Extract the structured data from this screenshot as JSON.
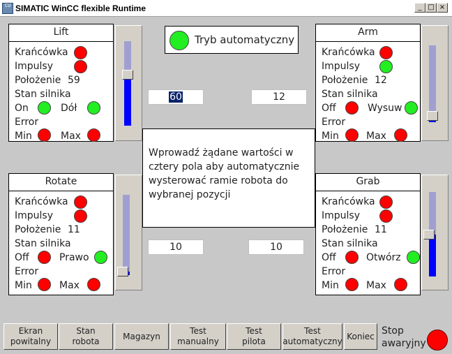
{
  "window": {
    "title": "SIMATIC WinCC flexible Runtime",
    "icon_label": "CU",
    "btn_min": "_",
    "btn_max": "□",
    "btn_close": "×"
  },
  "labels": {
    "limit": "Krańcówka",
    "impulses": "Impulsy",
    "position": "Położenie",
    "motor_state": "Stan silnika",
    "error": "Error",
    "min": "Min",
    "max": "Max"
  },
  "auto_mode": {
    "label": "Tryb automatyczny",
    "led": "green"
  },
  "panels": {
    "lift": {
      "title": "Lift",
      "limit_led": "red",
      "impulses_led": "red",
      "position": "59",
      "on_off": "On",
      "on_off_led": "green",
      "direction": "Dół",
      "direction_led": "green",
      "min_led": "red",
      "max_led": "red",
      "slider_level": 0.6
    },
    "arm": {
      "title": "Arm",
      "limit_led": "red",
      "impulses_led": "green",
      "position": "12",
      "on_off": "Off",
      "on_off_led": "red",
      "direction": "Wysuw",
      "direction_led": "green",
      "min_led": "red",
      "max_led": "red",
      "slider_level": 0.08
    },
    "rotate": {
      "title": "Rotate",
      "limit_led": "red",
      "impulses_led": "red",
      "position": "11",
      "on_off": "Off",
      "on_off_led": "red",
      "direction": "Prawo",
      "direction_led": "green",
      "min_led": "red",
      "max_led": "red",
      "slider_level": 0.04
    },
    "grab": {
      "title": "Grab",
      "limit_led": "red",
      "impulses_led": "red",
      "position": "11",
      "on_off": "Off",
      "on_off_led": "red",
      "direction": "Otwórz",
      "direction_led": "green",
      "min_led": "red",
      "max_led": "red",
      "slider_level": 0.5
    }
  },
  "inputs": {
    "lift": "60",
    "arm": "12",
    "rotate": "10",
    "grab": "10"
  },
  "info_text": "Wprowadź żądane wartości w cztery pola aby automatycznie wysterować ramie robota do wybranej pozycji",
  "nav": [
    {
      "line1": "Ekran",
      "line2": "powitalny"
    },
    {
      "line1": "Stan",
      "line2": "robota"
    },
    {
      "line1": "Magazyn",
      "line2": ""
    },
    {
      "line1": "Test",
      "line2": "manualny"
    },
    {
      "line1": "Test",
      "line2": "pilota"
    },
    {
      "line1": "Test",
      "line2": "automatyczny"
    },
    {
      "line1": "Koniec",
      "line2": ""
    }
  ],
  "stop": {
    "line1": "Stop",
    "line2": "awaryjny"
  },
  "colors": {
    "red": "#ff0000",
    "green": "#22ee22",
    "fill": "#0000ff",
    "background": "#c8c8c8"
  }
}
